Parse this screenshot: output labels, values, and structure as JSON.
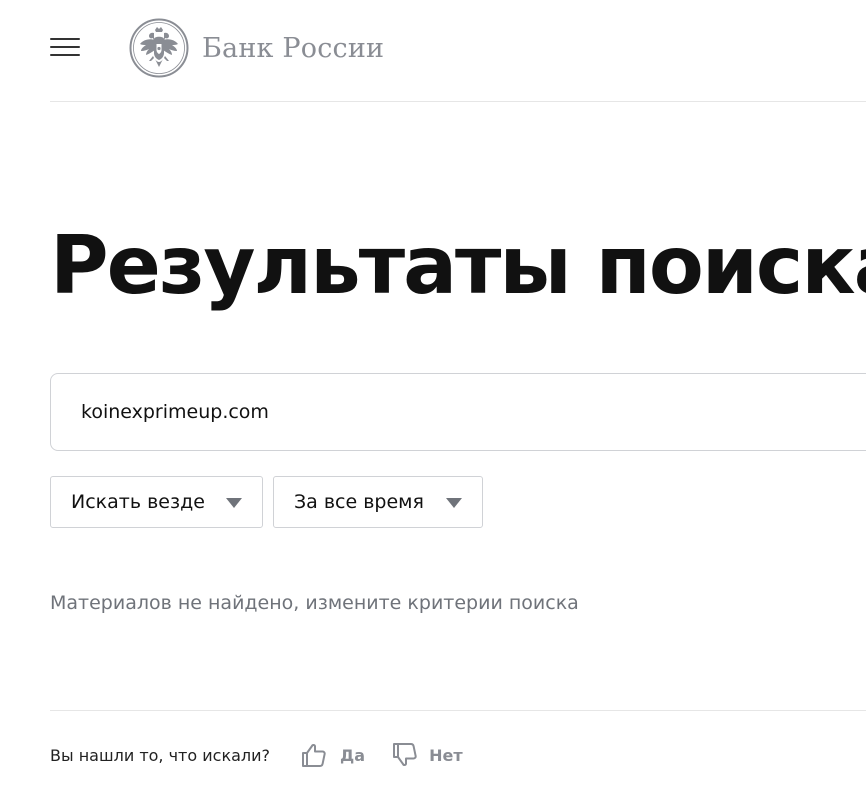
{
  "header": {
    "menu_icon": "hamburger-menu-icon",
    "logo_icon": "double-headed-eagle-emblem-icon",
    "logo_text": "Банк России"
  },
  "page": {
    "title": "Результаты поиска"
  },
  "search": {
    "value": "koinexprimeup.com",
    "placeholder": ""
  },
  "filters": {
    "where": {
      "label": "Искать везде",
      "icon": "caret-down-icon"
    },
    "time": {
      "label": "За все время",
      "icon": "caret-down-icon"
    }
  },
  "results": {
    "empty_message": "Материалов не найдено, измените критерии поиска"
  },
  "feedback": {
    "question": "Вы нашли то, что искали?",
    "yes_label": "Да",
    "yes_icon": "thumbs-up-icon",
    "no_label": "Нет",
    "no_icon": "thumbs-down-icon"
  },
  "colors": {
    "text": "#111111",
    "muted_text": "#6f737a",
    "logo_gray": "#8a8d94",
    "border": "#d0d2d6",
    "divider": "#e6e6e6"
  }
}
